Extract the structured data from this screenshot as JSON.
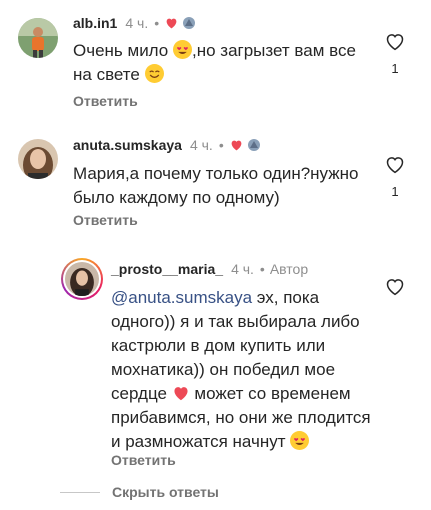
{
  "colors": {
    "heart": "#ed4956",
    "mention": "#385185",
    "muted": "#8e8e8e"
  },
  "comments": [
    {
      "username": "alb.in1",
      "time": "4 ч.",
      "separator": "•",
      "text_before_emoji": "Очень мило ",
      "text_after_emoji": ",но загрызет вам все на свете ",
      "reply_label": "Ответить",
      "like_count": "1"
    },
    {
      "username": "anuta.sumskaya",
      "time": "4 ч.",
      "separator": "•",
      "text": "Мария,а почему только один?нужно было каждому по одному)",
      "reply_label": "Ответить",
      "like_count": "1"
    },
    {
      "username": "_prosto__maria_",
      "time": "4 ч.",
      "separator": "•",
      "author_label": "Автор",
      "mention": "@anuta.sumskaya",
      "text_part1": " эх, пока одного)) я и так выбирала либо кастрюли в дом купить или мохнатика)) он победил мое сердце ",
      "text_part2": " может со временем прибавимся, но они же плодится и размножатся начнут ",
      "reply_label": "Ответить"
    }
  ],
  "hide_replies_label": "Скрыть ответы",
  "icons": {
    "heart": "heart-icon",
    "like": "like-heart-outline-icon",
    "emoji_love": "heart-eyes-emoji",
    "emoji_smile": "smile-emoji"
  }
}
